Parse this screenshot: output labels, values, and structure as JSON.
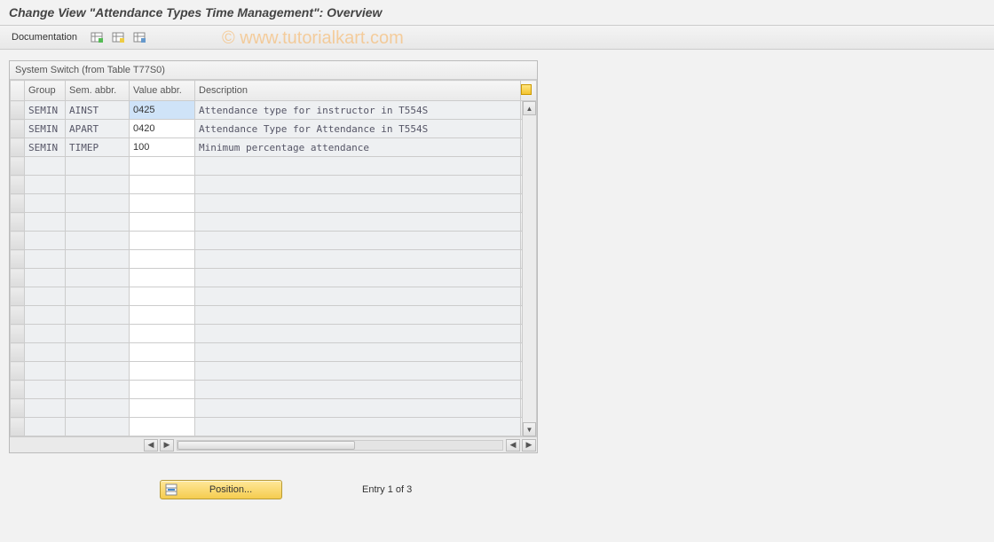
{
  "title": "Change View \"Attendance Types Time Management\": Overview",
  "toolbar": {
    "documentation_label": "Documentation",
    "icons": [
      "table-new-icon",
      "table-copy-icon",
      "table-delete-icon"
    ]
  },
  "watermark": "© www.tutorialkart.com",
  "panel": {
    "title": "System Switch (from Table T77S0)",
    "columns": {
      "group": "Group",
      "sem": "Sem. abbr.",
      "val": "Value abbr.",
      "desc": "Description"
    },
    "rows": [
      {
        "group": "SEMIN",
        "sem": "AINST",
        "val": "0425",
        "desc": "Attendance type for instructor in T554S",
        "focused": true
      },
      {
        "group": "SEMIN",
        "sem": "APART",
        "val": "0420",
        "desc": "Attendance Type for Attendance in T554S"
      },
      {
        "group": "SEMIN",
        "sem": "TIMEP",
        "val": "100",
        "desc": "Minimum percentage attendance"
      }
    ],
    "empty_rows": 15
  },
  "footer": {
    "position_label": "Position...",
    "entry_text": "Entry 1 of 3"
  }
}
